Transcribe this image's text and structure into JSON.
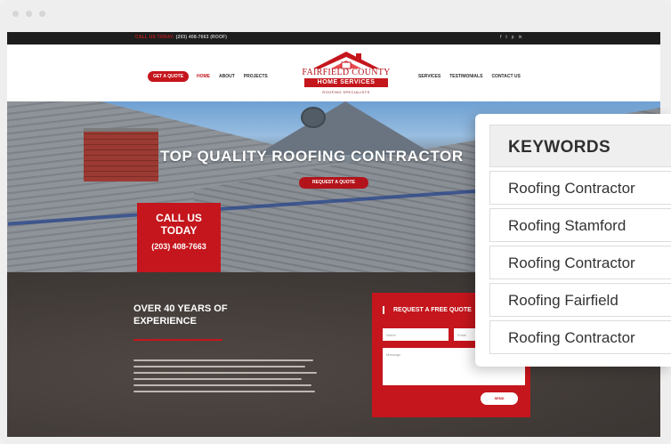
{
  "site": {
    "topbar": {
      "phone_prefix": "CALL US TODAY:",
      "phone": "(203) 408-7663 (ROOF)",
      "social": [
        "f",
        "t",
        "p",
        "in"
      ]
    },
    "nav": {
      "quote_button": "GET A QUOTE",
      "left_links": [
        "HOME",
        "ABOUT",
        "PROJECTS"
      ],
      "right_links": [
        "SERVICES",
        "TESTIMONIALS",
        "CONTACT US"
      ]
    },
    "logo": {
      "name": "FAIRFIELD COUNTY",
      "band": "HOME SERVICES",
      "tagline": "ROOFING SPECIALISTS"
    },
    "hero": {
      "title": "TOP QUALITY ROOFING CONTRACTOR",
      "button": "REQUEST A QUOTE"
    },
    "call_box": {
      "line1": "CALL US",
      "line2": "TODAY",
      "number": "(203) 408-7663"
    },
    "experience": {
      "line1": "OVER 40 YEARS OF",
      "line2": "EXPERIENCE"
    },
    "quote_form": {
      "title": "REQUEST A FREE QUOTE",
      "name_placeholder": "Name",
      "email_placeholder": "Email",
      "message_placeholder": "Message",
      "send_label": "SEND"
    }
  },
  "keywords_panel": {
    "header": "KEYWORDS",
    "items": [
      "Roofing Contractor",
      "Roofing Stamford",
      "Roofing Contractor",
      "Roofing Fairfield",
      "Roofing Contractor"
    ]
  },
  "colors": {
    "brand_red": "#c4161c",
    "dark_bar": "#1d1d1d",
    "footer_bg": "#423c39"
  }
}
